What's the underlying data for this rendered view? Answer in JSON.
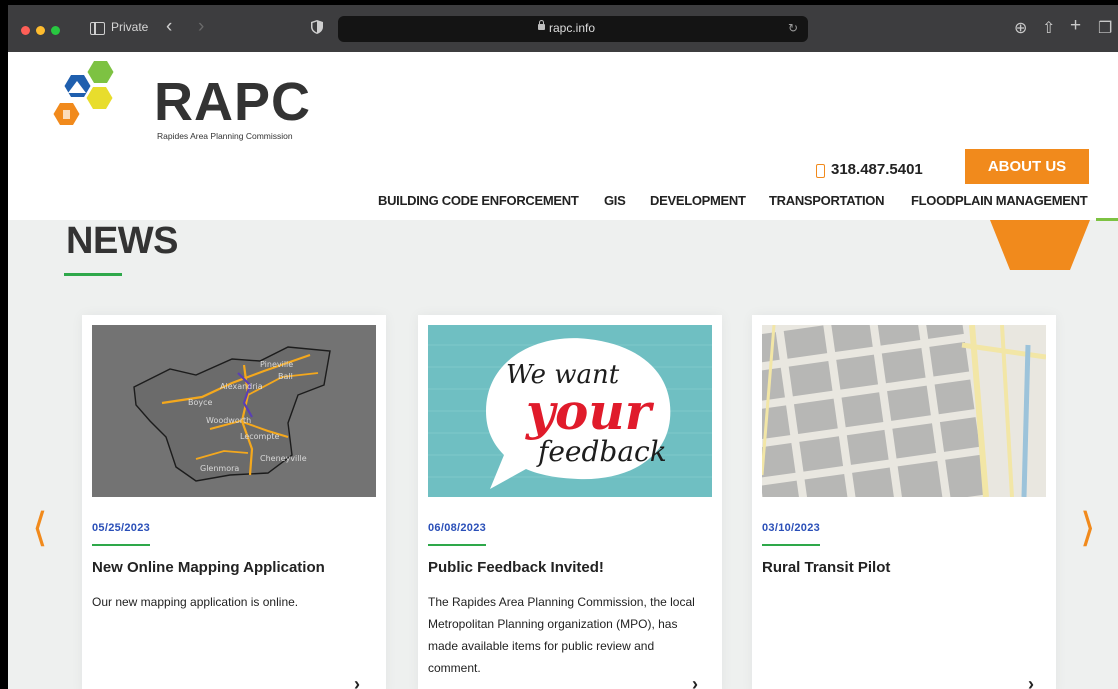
{
  "browser": {
    "mode_label": "Private",
    "url": "rapc.info"
  },
  "site": {
    "brand": "RAPC",
    "tagline": "Rapides Area Planning Commission",
    "phone": "318.487.5401",
    "about_label": "ABOUT US",
    "nav": [
      "BUILDING CODE ENFORCEMENT",
      "GIS",
      "DEVELOPMENT",
      "TRANSPORTATION",
      "FLOODPLAIN MANAGEMENT"
    ]
  },
  "news": {
    "title": "NEWS",
    "cards": [
      {
        "date": "05/25/2023",
        "title": "New Online Mapping Application",
        "body": "Our new mapping application is online.",
        "map_labels": [
          "Pineville",
          "Alexandria",
          "Woodworth",
          "Lecompte",
          "Cheneyville",
          "Glenmora",
          "Ball",
          "Boyce"
        ]
      },
      {
        "date": "06/08/2023",
        "title": "Public Feedback Invited!",
        "body": "The Rapides Area Planning Commission, the local Metropolitan Planning organization (MPO), has made available items for public review and comment.",
        "image_text": [
          "We want",
          "your",
          "feedback"
        ]
      },
      {
        "date": "03/10/2023",
        "title": "Rural Transit Pilot",
        "body": ""
      }
    ]
  },
  "colors": {
    "accent_orange": "#f18a1c",
    "accent_green": "#2ea84a",
    "date_blue": "#2a4fb8"
  },
  "icons": {
    "prev": "chevron-left-icon",
    "next": "chevron-right-icon",
    "phone": "phone-icon"
  }
}
